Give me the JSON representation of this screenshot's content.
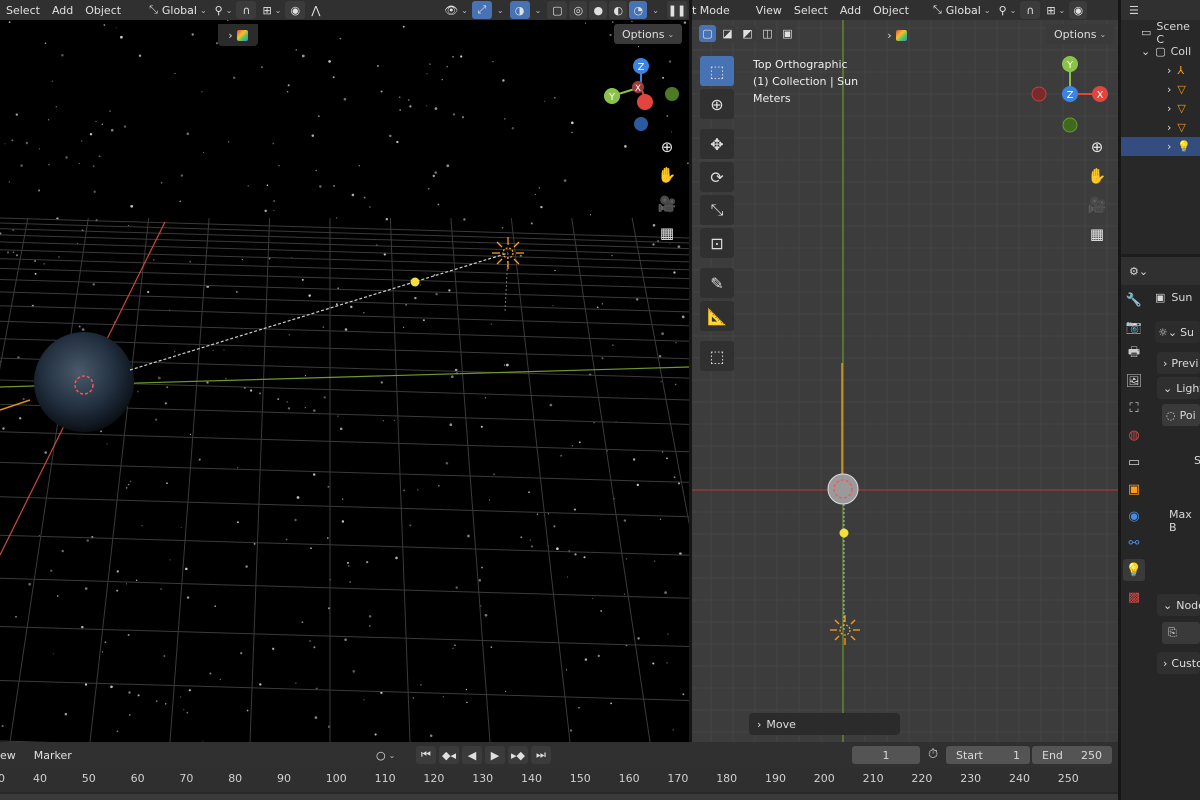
{
  "left_header": {
    "menus": [
      "Select",
      "Add",
      "Object"
    ],
    "orientation": "Global"
  },
  "left_viewport": {
    "options_label": "Options"
  },
  "right_header": {
    "mode_label": "t Mode",
    "menus": [
      "View",
      "Select",
      "Add",
      "Object"
    ],
    "orientation": "Global"
  },
  "right_viewport": {
    "options_label": "Options",
    "view_name": "Top Orthographic",
    "collection_line": "(1) Collection | Sun",
    "units": "Meters",
    "last_op": "Move"
  },
  "gizmo_left": {
    "z": "Z",
    "y": "Y",
    "x": "X"
  },
  "gizmo_right": {
    "z": "Z",
    "y": "Y",
    "x": "X"
  },
  "outliner": {
    "scene_label": "Scene C",
    "coll_label": "Coll"
  },
  "properties": {
    "object_name": "Sun",
    "light_name": "Su",
    "sections": {
      "preview": "Previ",
      "light": "Light",
      "point": "Poi",
      "s_label": "S",
      "maxb_label": "Max B",
      "nodes": "Node",
      "custom": "Custo"
    }
  },
  "timeline": {
    "menus": [
      "ew",
      "Marker"
    ],
    "current_frame": "1",
    "start_label": "Start",
    "start_value": "1",
    "end_label": "End",
    "end_value": "250",
    "ticks": [
      "0",
      "40",
      "50",
      "60",
      "70",
      "80",
      "90",
      "100",
      "110",
      "120",
      "130",
      "140",
      "150",
      "160",
      "170",
      "180",
      "190",
      "200",
      "210",
      "220",
      "230",
      "240",
      "250"
    ]
  },
  "colors": {
    "x_axis": "#e2453d",
    "y_axis": "#8bc34a",
    "z_axis": "#3d84e2",
    "accent": "#4772b3",
    "sun": "#ff9a1f"
  }
}
